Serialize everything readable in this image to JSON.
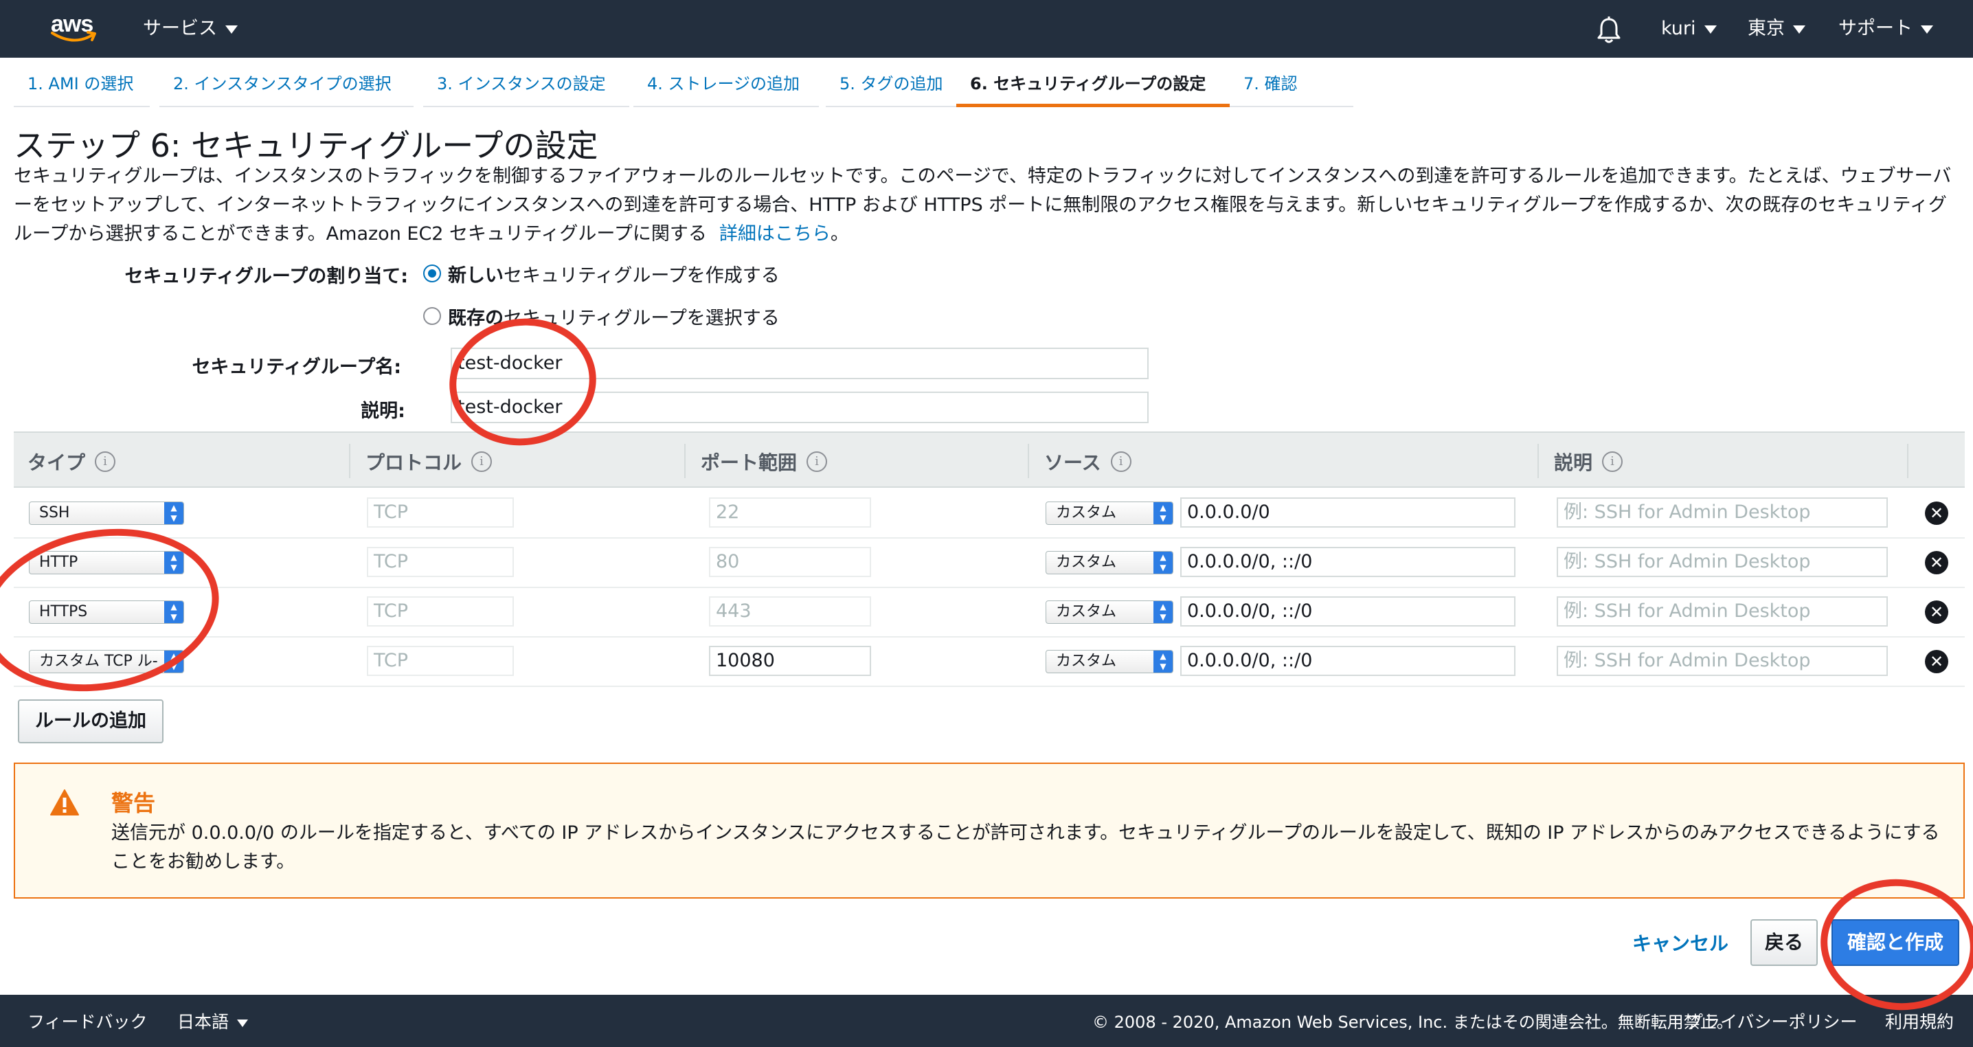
{
  "topnav": {
    "logo": "aws",
    "services": "サービス",
    "user": "kuri",
    "region": "東京",
    "support": "サポート"
  },
  "tabs": [
    {
      "label": "1. AMI の選択"
    },
    {
      "label": "2. インスタンスタイプの選択"
    },
    {
      "label": "3. インスタンスの設定"
    },
    {
      "label": "4. ストレージの追加"
    },
    {
      "label": "5. タグの追加"
    },
    {
      "label": "6. セキュリティグループの設定",
      "active": true
    },
    {
      "label": "7. 確認"
    }
  ],
  "page": {
    "title": "ステップ 6: セキュリティグループの設定",
    "description": "セキュリティグループは、インスタンスのトラフィックを制御するファイアウォールのルールセットです。このページで、特定のトラフィックに対してインスタンスへの到達を許可するルールを追加できます。たとえば、ウェブサーバーをセットアップして、インターネットトラフィックにインスタンスへの到達を許可する場合、HTTP および HTTPS ポートに無制限のアクセス権限を与えます。新しいセキュリティグループを作成するか、次の既存のセキュリティグループから選択することができます。Amazon EC2 セキュリティグループに関する",
    "details_link": "詳細はこちら",
    "details_suffix": "。"
  },
  "assign": {
    "label": "セキュリティグループの割り当て:",
    "option_new_bold": "新しい",
    "option_new_rest": "セキュリティグループを作成する",
    "option_existing_bold": "既存の",
    "option_existing_rest": "セキュリティグループを選択する",
    "selected": "new"
  },
  "group": {
    "name_label": "セキュリティグループ名:",
    "name_value": "test-docker",
    "desc_label": "説明:",
    "desc_value": "test-docker"
  },
  "table": {
    "headers": {
      "type": "タイプ",
      "protocol": "プロトコル",
      "port": "ポート範囲",
      "source": "ソース",
      "description": "説明"
    },
    "info_glyph": "i",
    "rows": [
      {
        "type": "SSH",
        "protocol": "TCP",
        "port": "22",
        "port_editable": false,
        "source_mode": "カスタム",
        "source": "0.0.0.0/0",
        "desc_placeholder": "例: SSH for Admin Desktop"
      },
      {
        "type": "HTTP",
        "protocol": "TCP",
        "port": "80",
        "port_editable": false,
        "source_mode": "カスタム",
        "source": "0.0.0.0/0, ::/0",
        "desc_placeholder": "例: SSH for Admin Desktop"
      },
      {
        "type": "HTTPS",
        "protocol": "TCP",
        "port": "443",
        "port_editable": false,
        "source_mode": "カスタム",
        "source": "0.0.0.0/0, ::/0",
        "desc_placeholder": "例: SSH for Admin Desktop"
      },
      {
        "type": "カスタム TCP ル-",
        "protocol": "TCP",
        "port": "10080",
        "port_editable": true,
        "source_mode": "カスタム",
        "source": "0.0.0.0/0, ::/0",
        "desc_placeholder": "例: SSH for Admin Desktop"
      }
    ],
    "add_rule": "ルールの追加"
  },
  "warning": {
    "title": "警告",
    "text": "送信元が 0.0.0.0/0 のルールを指定すると、すべての IP アドレスからインスタンスにアクセスすることが許可されます。セキュリティグループのルールを設定して、既知の IP アドレスからのみアクセスできるようにすることをお勧めします。",
    "color": "#ec7211"
  },
  "actions": {
    "cancel": "キャンセル",
    "back": "戻る",
    "review_launch": "確認と作成"
  },
  "footer": {
    "feedback": "フィードバック",
    "language": "日本語",
    "copyright": "© 2008 - 2020, Amazon Web Services, Inc. またはその関連会社。無断転用禁止。",
    "privacy": "プライバシーポリシー",
    "terms": "利用規約"
  },
  "colors": {
    "nav_bg": "#232f3e",
    "link": "#0073bb",
    "accent": "#ec7211",
    "primary_button": "#2d7de4",
    "annotation": "#e8392a"
  }
}
